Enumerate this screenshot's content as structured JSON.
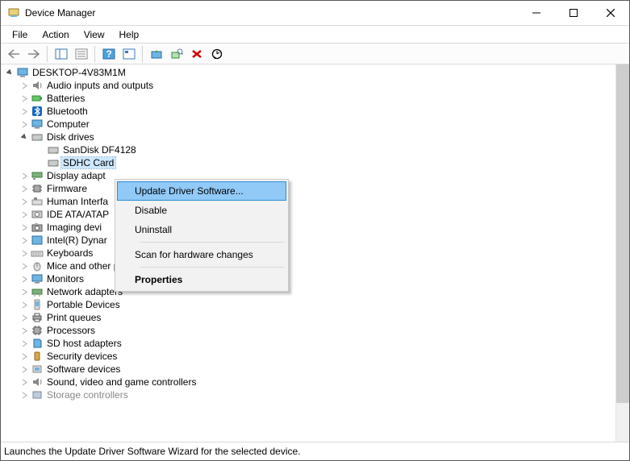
{
  "window": {
    "title": "Device Manager"
  },
  "menu": {
    "file": "File",
    "action": "Action",
    "view": "View",
    "help": "Help"
  },
  "tree": {
    "root": "DESKTOP-4V83M1M",
    "nodes": {
      "audio": "Audio inputs and outputs",
      "batteries": "Batteries",
      "bluetooth": "Bluetooth",
      "computer": "Computer",
      "diskdrives": "Disk drives",
      "disk_sandisk": "SanDisk DF4128",
      "disk_sdhc": "SDHC Card",
      "display": "Display adapt",
      "firmware": "Firmware",
      "hid": "Human Interfa",
      "ide": "IDE ATA/ATAP",
      "imaging": "Imaging devi",
      "intel": "Intel(R) Dynar",
      "keyboards": "Keyboards",
      "mice": "Mice and other pointing devices",
      "monitors": "Monitors",
      "network": "Network adapters",
      "portable": "Portable Devices",
      "printq": "Print queues",
      "processors": "Processors",
      "sdhost": "SD host adapters",
      "security": "Security devices",
      "software": "Software devices",
      "sound": "Sound, video and game controllers",
      "storage": "Storage controllers"
    }
  },
  "context": {
    "update": "Update Driver Software...",
    "disable": "Disable",
    "uninstall": "Uninstall",
    "scan": "Scan for hardware changes",
    "properties": "Properties"
  },
  "status": "Launches the Update Driver Software Wizard for the selected device."
}
